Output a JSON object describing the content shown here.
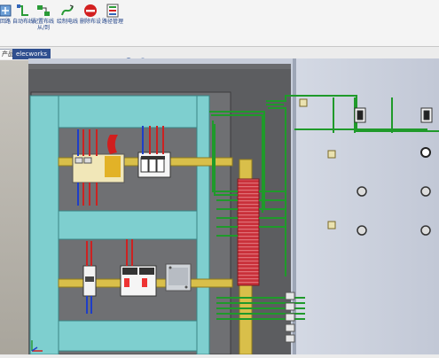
{
  "ribbon": {
    "buttons": [
      {
        "label": "回路",
        "icon": "circuit-icon"
      },
      {
        "label": "自动布线",
        "icon": "auto-route-icon"
      },
      {
        "label": "配置布线从/到",
        "icon": "wire-from-to-icon"
      },
      {
        "label": "绘制电线",
        "icon": "draw-wire-icon"
      },
      {
        "label": "删除布设",
        "icon": "delete-route-icon"
      },
      {
        "label": "路径管理",
        "icon": "route-manager-icon"
      }
    ]
  },
  "tabs": [
    {
      "label": "产品",
      "active": false
    },
    {
      "label": "elecworks",
      "active": true
    }
  ],
  "colors": {
    "cabinet": "#5c5d60",
    "rail": "#7ecfcf",
    "dinrail": "#d9bf4a",
    "duct": "#c9303a",
    "wire": "#1f9a2a",
    "door": "#c8cedb"
  }
}
